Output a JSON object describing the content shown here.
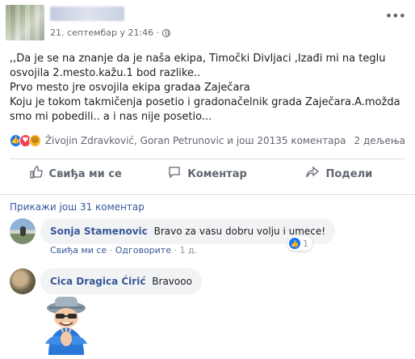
{
  "post": {
    "timestamp": "21. септембар у 21:46 ·",
    "text_lines": [
      ",,Da je se na znanje da je naša ekipa, Timočki Divljaci ,Izađi mi na teglu osvojila 2.mesto.kažu.1 bod razlike..",
      "Prvo mesto jre osvojila ekipa gradaa Zaječara",
      "Koju je tokom takmičenja posetio i gradonačelnik grada Zaječara.A.možda smo mi pobedili.. a i nas nije posetio..."
    ]
  },
  "reactions": {
    "icons": [
      "like-reaction",
      "love-reaction",
      "haha-reaction"
    ],
    "names": "Živojin Zdravković, Goran Petrunovic и још 201",
    "comments_count": "35 коментара",
    "shares_count": "2 дељења"
  },
  "actions": {
    "like": "Свиђа ми се",
    "comment": "Коментар",
    "share": "Подели"
  },
  "comments_section": {
    "show_more": "Прикажи још 31 коментар",
    "comments": [
      {
        "author": "Sonja Stamenovic",
        "text": "Bravo za vasu dobru volju i umece!",
        "like_link": "Свиђа ми се",
        "reply_link": "Одговорите",
        "age": "1 д.",
        "reaction_count": "1"
      },
      {
        "author": "Cica Dragica Ćirić",
        "text": "Bravooo",
        "sticker": "clapping-man-sticker"
      }
    ]
  },
  "colors": {
    "link": "#385898",
    "secondary_text": "#616770",
    "like_blue": "#1877f2",
    "love_red": "#f33e58",
    "haha_yellow": "#f7b125"
  }
}
